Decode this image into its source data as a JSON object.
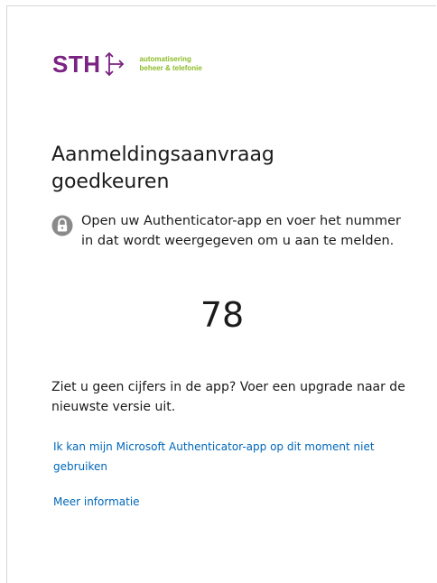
{
  "logo": {
    "mark": "STH",
    "tagline_line1": "automatisering",
    "tagline_line2": "beheer & telefonie",
    "mark_color": "#7b2382",
    "tagline_color": "#8dbb28"
  },
  "title": "Aanmeldingsaanvraag goedkeuren",
  "instruction": {
    "icon": "lock-icon",
    "text": "Open uw Authenticator-app en voer het nummer in dat wordt weergegeven om u aan te melden."
  },
  "number": "78",
  "hint": "Ziet u geen cijfers in de app? Voer een upgrade naar de nieuwste versie uit.",
  "links": {
    "cannot_use": "Ik kan mijn Microsoft Authenticator-app op dit moment niet gebruiken",
    "more_info": "Meer informatie",
    "color": "#0067b8"
  }
}
